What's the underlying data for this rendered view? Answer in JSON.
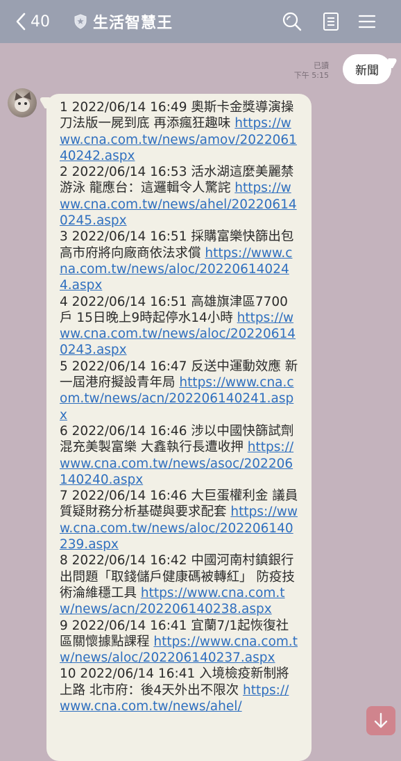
{
  "header": {
    "back_count": "40",
    "title": "生活智慧王",
    "icons": [
      "back-chevron-icon",
      "shield-icon",
      "search-icon",
      "notes-icon",
      "menu-icon"
    ]
  },
  "outgoing": {
    "text": "新聞",
    "read": "已讀",
    "time": "下午 5:15"
  },
  "incoming": {
    "items": [
      {
        "text": "1 2022/06/14 16:49 奧斯卡金獎導演操刀法版一屍到底 再添瘋狂趣味 ",
        "link": "https://www.cna.com.tw/news/amov/202206140242.aspx"
      },
      {
        "text": "2 2022/06/14 16:53 活水湖這麼美麗禁游泳 龍應台：這邏輯令人驚詫 ",
        "link": "https://www.cna.com.tw/news/ahel/202206140245.aspx"
      },
      {
        "text": "3 2022/06/14 16:51 採購富樂快篩出包 高市府將向廠商依法求償 ",
        "link": "https://www.cna.com.tw/news/aloc/202206140244.aspx"
      },
      {
        "text": "4 2022/06/14 16:51 高雄旗津區7700戶 15日晚上9時起停水14小時 ",
        "link": "https://www.cna.com.tw/news/aloc/202206140243.aspx"
      },
      {
        "text": "5 2022/06/14 16:47 反送中運動效應 新一屆港府擬設青年局 ",
        "link": "https://www.cna.com.tw/news/acn/202206140241.aspx"
      },
      {
        "text": "6 2022/06/14 16:46 涉以中國快篩試劑混充美製富樂 大鑫執行長遭收押 ",
        "link": "https://www.cna.com.tw/news/asoc/202206140240.aspx"
      },
      {
        "text": "7 2022/06/14 16:46 大巨蛋權利金 議員質疑財務分析基礎與要求配套 ",
        "link": "https://www.cna.com.tw/news/aloc/202206140239.aspx"
      },
      {
        "text": "8 2022/06/14 16:42 中國河南村鎮銀行出問題「取錢儲戶健康碼被轉紅」 防疫技術淪維穩工具 ",
        "link": "https://www.cna.com.tw/news/acn/202206140238.aspx"
      },
      {
        "text": "9 2022/06/14 16:41 宜蘭7/1起恢復社區關懷據點課程 ",
        "link": "https://www.cna.com.tw/news/aloc/202206140237.aspx"
      },
      {
        "text": "10 2022/06/14 16:41 入境檢疫新制將上路 北市府：後4天外出不限次 ",
        "link": "https://www.cna.com.tw/news/ahel/"
      }
    ]
  },
  "colors": {
    "header_bg": "#9aa0b0",
    "chat_bg": "#c4b3bd",
    "incoming_bubble": "#f2f0e6",
    "link": "#2f6fbf",
    "scroll_button": "#d27f88"
  }
}
